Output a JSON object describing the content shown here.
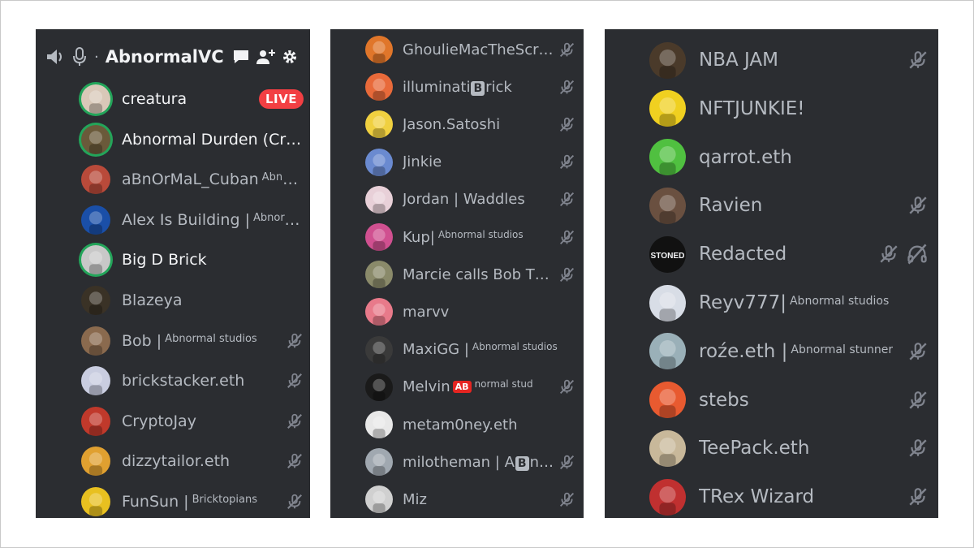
{
  "channel": {
    "name": "AbnormalVC",
    "separator": "·",
    "live_label": "LIVE"
  },
  "panel1": [
    {
      "name": "creatura",
      "tag": "",
      "active": true,
      "speaking": true,
      "muted": false,
      "live": true,
      "color": "#d9c8b8",
      "icon": "avatar-creatura"
    },
    {
      "name": "Abnormal Durden (Cryp…",
      "tag": "",
      "active": true,
      "speaking": true,
      "muted": false,
      "color": "#6a5a3a",
      "icon": "avatar-abnormal-durden"
    },
    {
      "name": "aBnOrMaL_Cuban",
      "tag": "Abnorm…",
      "active": false,
      "speaking": false,
      "muted": false,
      "color": "#b94a3a",
      "icon": "avatar-cuban"
    },
    {
      "name": "Alex Is Building |",
      "tag": "Abnormal",
      "active": false,
      "speaking": false,
      "muted": false,
      "color": "#1a4fa8",
      "icon": "avatar-alex"
    },
    {
      "name": "Big D Brick",
      "tag": "",
      "active": true,
      "speaking": true,
      "muted": false,
      "color": "#c8c8c8",
      "icon": "avatar-big-d-brick"
    },
    {
      "name": "Blazeya",
      "tag": "",
      "active": false,
      "speaking": false,
      "muted": false,
      "color": "#3a3226",
      "icon": "avatar-blazeya"
    },
    {
      "name": "Bob |",
      "tag": "Abnormal studios",
      "active": false,
      "speaking": false,
      "muted": true,
      "color": "#8a6a4e",
      "icon": "avatar-bob"
    },
    {
      "name": "brickstacker.eth",
      "tag": "",
      "active": false,
      "speaking": false,
      "muted": true,
      "color": "#c9cde0",
      "icon": "avatar-brickstacker"
    },
    {
      "name": "CryptoJay",
      "tag": "",
      "active": false,
      "speaking": false,
      "muted": true,
      "color": "#c0392b",
      "icon": "avatar-cryptojay"
    },
    {
      "name": "dizzytailor.eth",
      "tag": "",
      "active": false,
      "speaking": false,
      "muted": true,
      "color": "#e0a030",
      "icon": "avatar-dizzytailor"
    },
    {
      "name": "FunSun |",
      "tag": "Bricktopians",
      "active": false,
      "speaking": false,
      "muted": true,
      "color": "#e8c020",
      "icon": "avatar-funsun"
    }
  ],
  "panel2": [
    {
      "name": "GhoulieMacTheScr…",
      "tag": "",
      "muted": true,
      "color": "#e0762a",
      "icon": "avatar-ghoulie"
    },
    {
      "name_pre": "illuminati",
      "name_box": "B",
      "name_post": "rick",
      "tag": "",
      "muted": true,
      "color": "#e86a3a",
      "icon": "avatar-illuminatibrick"
    },
    {
      "name": "Jason.Satoshi",
      "tag": "",
      "muted": true,
      "color": "#f0d040",
      "icon": "avatar-jason-satoshi"
    },
    {
      "name": "Jinkie",
      "tag": "",
      "muted": true,
      "color": "#6a8ad0",
      "icon": "avatar-jinkie"
    },
    {
      "name": "Jordan | Waddles",
      "tag": "",
      "muted": true,
      "color": "#e8d0d8",
      "icon": "avatar-jordan"
    },
    {
      "name": "Kup|",
      "tag": "Abnormal studios",
      "muted": true,
      "color": "#d05090",
      "icon": "avatar-kup"
    },
    {
      "name": "Marcie calls Bob T…",
      "tag": "",
      "muted": true,
      "color": "#8a8a6a",
      "icon": "avatar-marcie"
    },
    {
      "name": "marvv",
      "tag": "",
      "muted": false,
      "color": "#e87a8a",
      "icon": "avatar-marvv"
    },
    {
      "name": "MaxiGG |",
      "tag": "Abnormal studios",
      "muted": false,
      "color": "#3a3a3a",
      "icon": "avatar-maxigg"
    },
    {
      "name": "Melvin",
      "badge": "AB",
      "tag": "normal stud",
      "muted": true,
      "color": "#1a1a1a",
      "icon": "avatar-melvin"
    },
    {
      "name": "metam0ney.eth",
      "tag": "",
      "muted": false,
      "color": "#e8e8e8",
      "icon": "avatar-metam0ney"
    },
    {
      "name_pre": "milotheman | A",
      "name_box": "B",
      "name_post": "n…",
      "tag": "",
      "muted": true,
      "color": "#a0a8b0",
      "icon": "avatar-milotheman"
    },
    {
      "name": "Miz",
      "tag": "",
      "muted": true,
      "color": "#d0d0d0",
      "icon": "avatar-miz"
    }
  ],
  "panel3": [
    {
      "name": "NBA JAM",
      "tag": "",
      "muted": true,
      "deafened": false,
      "color": "#4a3a2a",
      "icon": "avatar-nba-jam"
    },
    {
      "name": "NFTJUNKIE!",
      "tag": "",
      "muted": false,
      "deafened": false,
      "color": "#f0d020",
      "icon": "avatar-nftjunkie"
    },
    {
      "name": "qarrot.eth",
      "tag": "",
      "muted": false,
      "deafened": false,
      "color": "#50c040",
      "icon": "avatar-qarrot"
    },
    {
      "name": "Ravien",
      "tag": "",
      "muted": true,
      "deafened": false,
      "color": "#6a5040",
      "icon": "avatar-ravien"
    },
    {
      "name": "Redacted",
      "tag": "",
      "muted": true,
      "deafened": true,
      "color": "#111111",
      "icon": "avatar-redacted",
      "avatar_text": "STONED"
    },
    {
      "name": "Reyv777|",
      "tag": "Abnormal studios",
      "muted": false,
      "deafened": false,
      "color": "#d8dde6",
      "icon": "avatar-reyv777"
    },
    {
      "name": "roźe.eth |",
      "tag": "Abnormal stunner",
      "muted": true,
      "deafened": false,
      "color": "#9ab0b8",
      "icon": "avatar-roze"
    },
    {
      "name": "stebs",
      "tag": "",
      "muted": true,
      "deafened": false,
      "color": "#e85a30",
      "icon": "avatar-stebs"
    },
    {
      "name": "TeePack.eth",
      "tag": "",
      "muted": true,
      "deafened": false,
      "color": "#c8b89a",
      "icon": "avatar-teepack"
    },
    {
      "name": "TRex Wizard",
      "tag": "",
      "muted": true,
      "deafened": false,
      "color": "#c03030",
      "icon": "avatar-trex-wizard"
    }
  ],
  "colors": {
    "panel_bg": "#2b2d31",
    "text_active": "#f2f3f5",
    "text_muted": "#b5bac1",
    "speaking_ring": "#23a55a",
    "live_badge": "#f23f43"
  }
}
